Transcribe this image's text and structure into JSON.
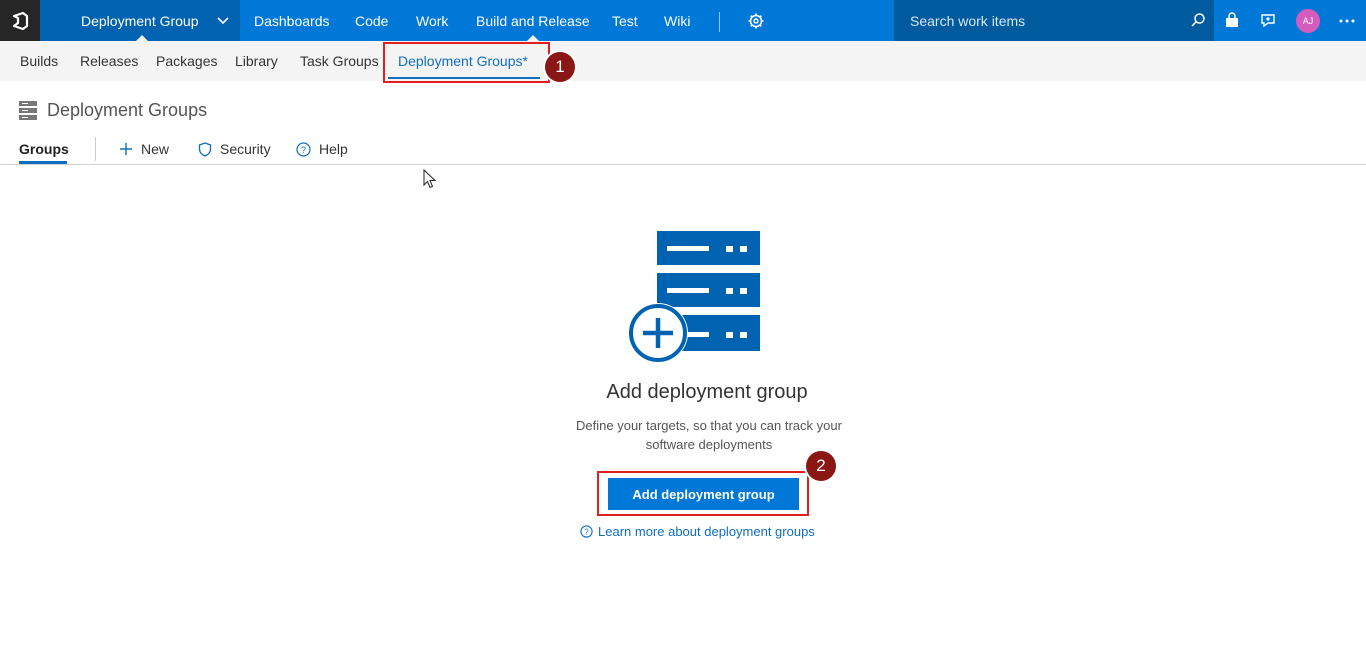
{
  "topbar": {
    "project": "Deployment Group",
    "nav": [
      "Dashboards",
      "Code",
      "Work",
      "Build and Release",
      "Test",
      "Wiki"
    ],
    "active_nav": "Build and Release",
    "search_placeholder": "Search work items",
    "avatar_initials": "AJ",
    "colors": {
      "bar": "#0078d7",
      "project": "#0063b1",
      "search": "#005a9e",
      "logo": "#262626"
    }
  },
  "subnav": {
    "items": [
      "Builds",
      "Releases",
      "Packages",
      "Library",
      "Task Groups",
      "Deployment Groups*"
    ],
    "selected": "Deployment Groups*"
  },
  "page": {
    "title": "Deployment Groups",
    "pivot": "Groups",
    "toolbar": {
      "new": "New",
      "security": "Security",
      "help": "Help"
    }
  },
  "empty_state": {
    "title": "Add deployment group",
    "description": "Define your targets, so that you can track your software deployments",
    "button": "Add deployment group",
    "learn_more": "Learn more about deployment groups"
  },
  "annotations": {
    "badge1": "1",
    "badge2": "2",
    "highlight_color": "#e02020",
    "badge_color": "#8b1616"
  }
}
